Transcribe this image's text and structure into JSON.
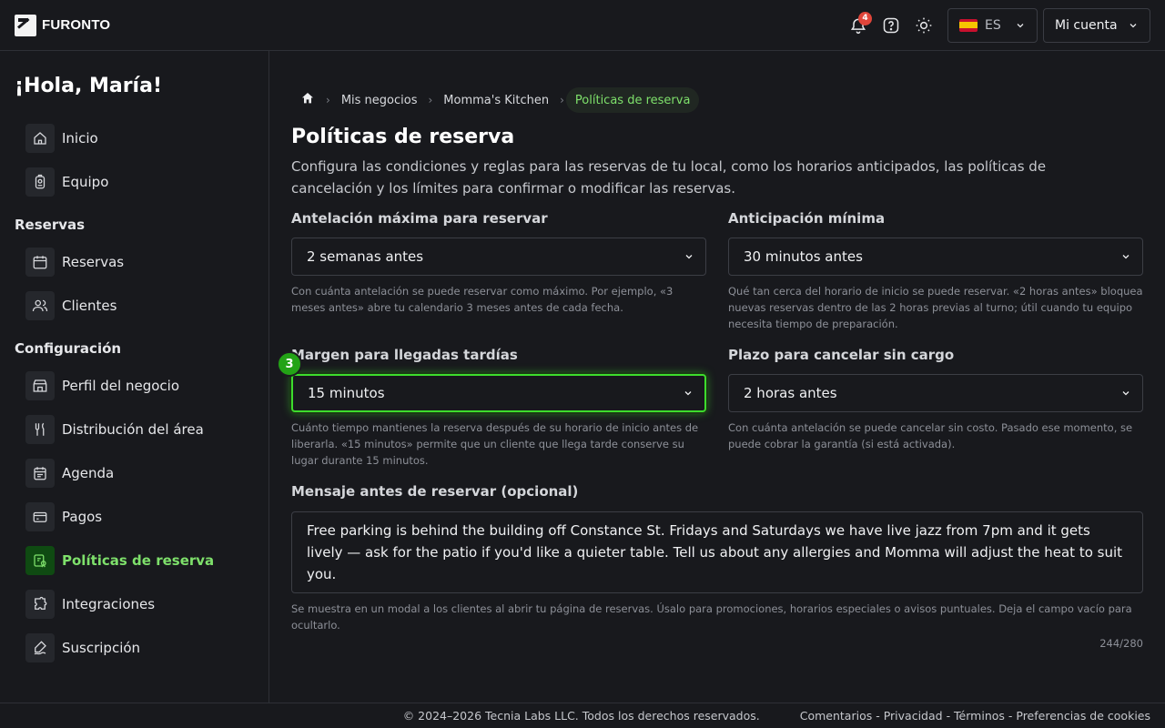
{
  "brand": {
    "name": "FURONTO"
  },
  "header": {
    "notifications_count": "4",
    "language": "ES",
    "account_label": "Mi cuenta"
  },
  "sidebar": {
    "greeting": "¡Hola, María!",
    "items_top": [
      {
        "label": "Inicio",
        "icon": "home-icon"
      },
      {
        "label": "Equipo",
        "icon": "team-icon"
      }
    ],
    "section_reservas": "Reservas",
    "items_reservas": [
      {
        "label": "Reservas",
        "icon": "calendar-icon"
      },
      {
        "label": "Clientes",
        "icon": "users-icon"
      }
    ],
    "section_config": "Configuración",
    "items_config": [
      {
        "label": "Perfil del negocio",
        "icon": "store-icon"
      },
      {
        "label": "Distribución del área",
        "icon": "cutlery-icon"
      },
      {
        "label": "Agenda",
        "icon": "agenda-icon"
      },
      {
        "label": "Pagos",
        "icon": "card-icon"
      },
      {
        "label": "Políticas de reserva",
        "icon": "policy-icon",
        "active": true
      },
      {
        "label": "Integraciones",
        "icon": "puzzle-icon"
      },
      {
        "label": "Suscripción",
        "icon": "signature-icon"
      }
    ]
  },
  "breadcrumb": {
    "items": [
      "Mis negocios",
      "Momma's Kitchen"
    ],
    "current": "Políticas de reserva"
  },
  "page": {
    "title": "Políticas de reserva",
    "description": "Configura las condiciones y reglas para las reservas de tu local, como los horarios anticipados, las políticas de cancelación y los límites para confirmar o modificar las reservas."
  },
  "fields": {
    "max_advance": {
      "label": "Antelación máxima para reservar",
      "value": "2 semanas antes",
      "help": "Con cuánta antelación se puede reservar como máximo. Por ejemplo, «3 meses antes» abre tu calendario 3 meses antes de cada fecha."
    },
    "min_advance": {
      "label": "Anticipación mínima",
      "value": "30 minutos antes",
      "help": "Qué tan cerca del horario de inicio se puede reservar. «2 horas antes» bloquea nuevas reservas dentro de las 2 horas previas al turno; útil cuando tu equipo necesita tiempo de preparación."
    },
    "late_margin": {
      "label": "Margen para llegadas tardías",
      "value": "15 minutos",
      "step": "3",
      "help": "Cuánto tiempo mantienes la reserva después de su horario de inicio antes de liberarla. «15 minutos» permite que un cliente que llega tarde conserve su lugar durante 15 minutos."
    },
    "cancel_window": {
      "label": "Plazo para cancelar sin cargo",
      "value": "2 horas antes",
      "help": "Con cuánta antelación se puede cancelar sin costo. Pasado ese momento, se puede cobrar la garantía (si está activada)."
    },
    "message": {
      "label": "Mensaje antes de reservar (opcional)",
      "value": "Free parking is behind the building off Constance St. Fridays and Saturdays we have live jazz from 7pm and it gets lively — ask for the patio if you'd like a quieter table. Tell us about any allergies and Momma will adjust the heat to suit you.",
      "help": "Se muestra en un modal a los clientes al abrir tu página de reservas. Úsalo para promociones, horarios especiales o avisos puntuales. Deja el campo vacío para ocultarlo.",
      "counter": "244/280"
    }
  },
  "footer": {
    "copyright": "© 2024–2026 Tecnia Labs LLC. Todos los derechos reservados.",
    "links": [
      "Comentarios",
      "Privacidad",
      "Términos",
      "Preferencias de cookies"
    ]
  },
  "colors": {
    "accent": "#7ee06b",
    "focus": "#3ddc2c",
    "badge": "#e0453a"
  }
}
